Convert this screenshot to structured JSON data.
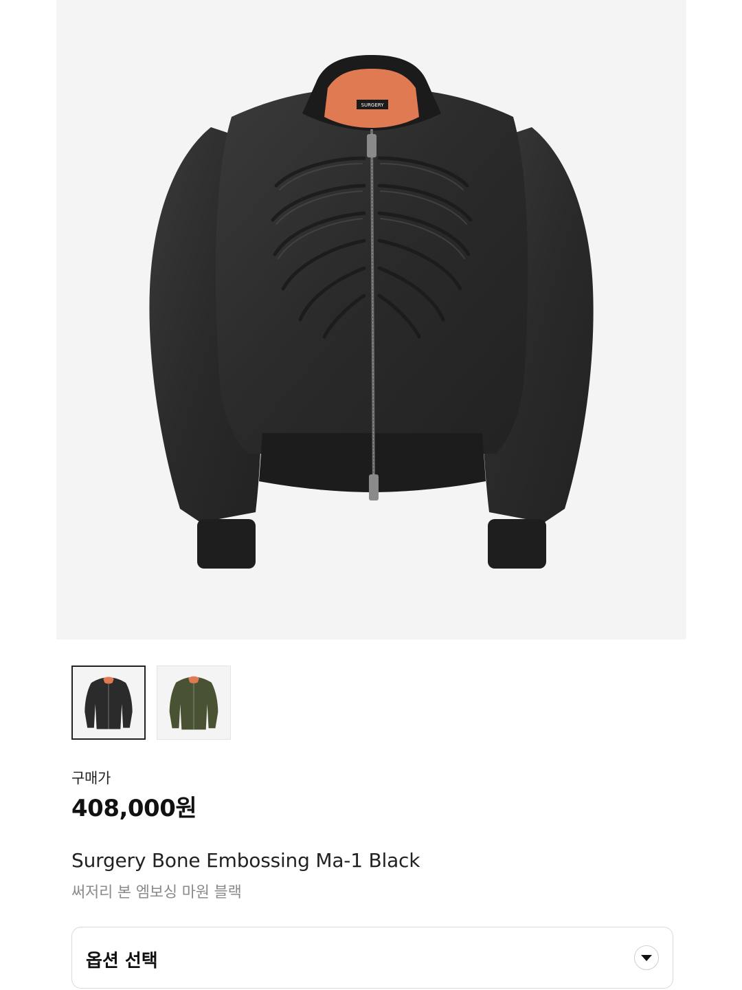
{
  "product": {
    "price_label": "구매가",
    "price": "408,000원",
    "name_en": "Surgery Bone Embossing Ma-1 Black",
    "name_ko": "써저리 본 엠보싱 마원 블랙",
    "brand_tag": "SURGERY"
  },
  "thumbnails": [
    {
      "color_name": "black",
      "jacket_color": "#2b2b2b",
      "selected": true
    },
    {
      "color_name": "olive",
      "jacket_color": "#4a5234",
      "selected": false
    }
  ],
  "option_select": {
    "label": "옵션 선택"
  },
  "colors": {
    "hero_bg": "#f4f4f4",
    "jacket_black": "#2a2a2a",
    "lining_orange": "#e07a52"
  }
}
